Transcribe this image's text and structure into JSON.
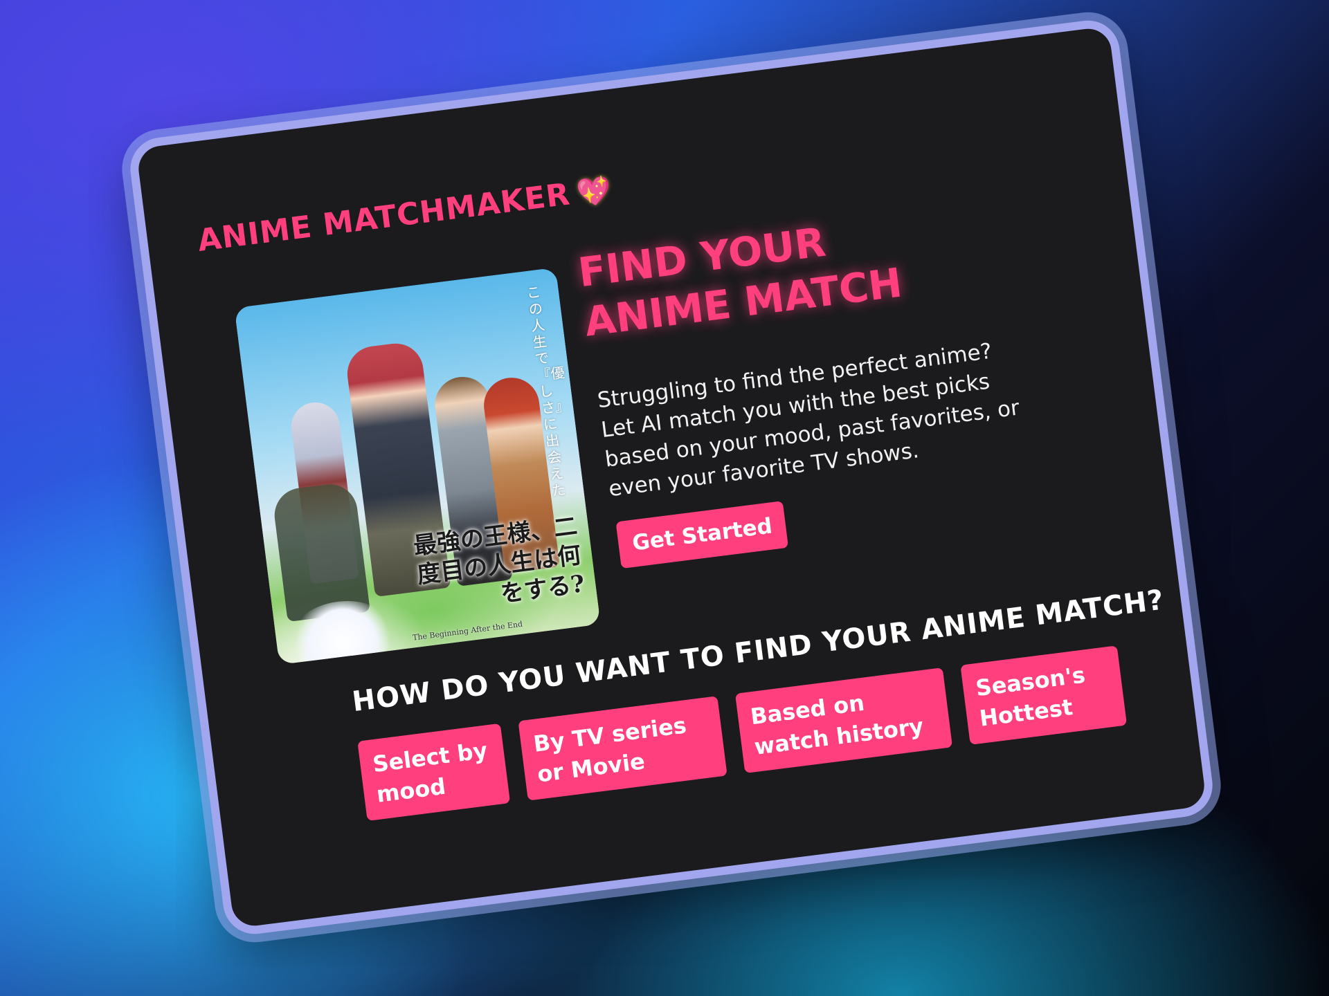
{
  "app": {
    "brand": "Anime Matchmaker",
    "brand_icon": "sparkling-heart-icon"
  },
  "hero": {
    "title": "Find Your Anime Match",
    "description": "Struggling to find the perfect anime? Let AI match you with the best picks based on your mood, past favorites, or even your favorite TV shows.",
    "cta_label": "Get Started",
    "poster": {
      "vertical_text": "この人生で『優しさ』に出会えた",
      "japanese_title": "最強の王様、二度目の人生は何をする?",
      "english_title": "The Beginning After the End"
    }
  },
  "options_section": {
    "title": "How do you want to find your anime match?",
    "options": [
      {
        "label": "Select by mood"
      },
      {
        "label": "By TV series or Movie"
      },
      {
        "label": "Based on watch history"
      },
      {
        "label": "Season's Hottest"
      }
    ]
  },
  "colors": {
    "accent": "#ff3f7e",
    "card_background": "#1b1b1d",
    "card_border": "#a2a6ef",
    "text_primary": "#ffffff"
  }
}
